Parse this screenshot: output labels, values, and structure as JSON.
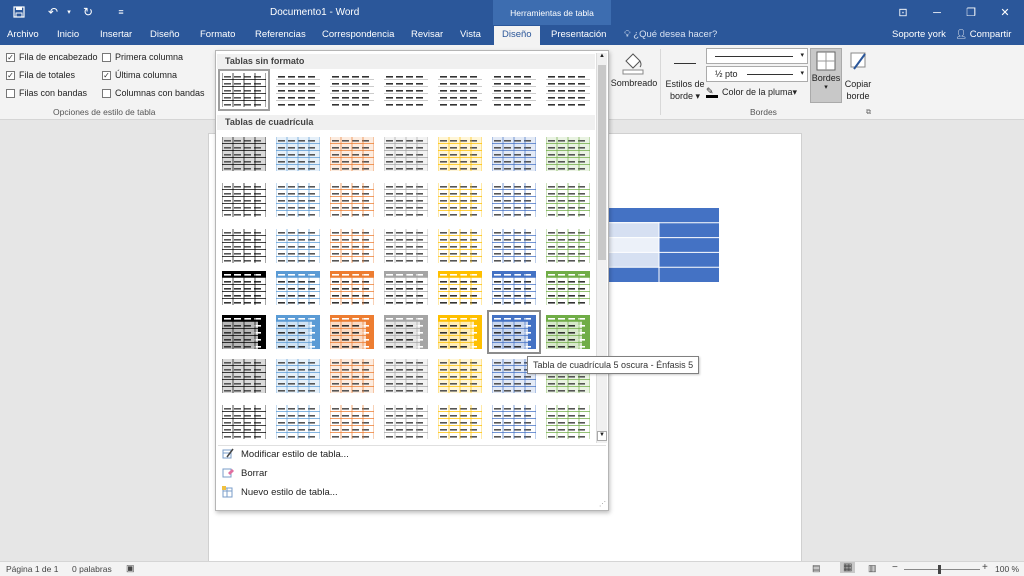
{
  "titlebar": {
    "title": "Documento1 - Word",
    "context_tab_group": "Herramientas de tabla"
  },
  "tabs": [
    "Archivo",
    "Inicio",
    "Insertar",
    "Diseño",
    "Formato",
    "Referencias",
    "Correspondencia",
    "Revisar",
    "Vista",
    "Diseño",
    "Presentación"
  ],
  "active_tab_index": 9,
  "tell_me": "¿Qué desea hacer?",
  "account": {
    "user": "Soporte york",
    "share": "Compartir"
  },
  "style_options": {
    "items": [
      {
        "label": "Fila de encabezado",
        "checked": true
      },
      {
        "label": "Fila de totales",
        "checked": true
      },
      {
        "label": "Filas con bandas",
        "checked": false
      },
      {
        "label": "Primera columna",
        "checked": false
      },
      {
        "label": "Última columna",
        "checked": true
      },
      {
        "label": "Columnas con bandas",
        "checked": false
      }
    ],
    "group_label": "Opciones de estilo de tabla"
  },
  "borders": {
    "sombreado": "Sombreado",
    "estilos_line1": "Estilos de",
    "estilos_line2": "borde",
    "weight": "½ pto",
    "pen_color": "Color de la pluma",
    "bordes": "Bordes",
    "copiar_line1": "Copiar",
    "copiar_line2": "borde",
    "group_label": "Bordes"
  },
  "gallery": {
    "section_plain": "Tablas sin formato",
    "section_grid": "Tablas de cuadrícula",
    "tooltip": "Tabla de cuadrícula 5 oscura - Énfasis 5",
    "menu": [
      {
        "label": "Modificar estilo de tabla...",
        "icon": "edit-table-style-icon"
      },
      {
        "label": "Borrar",
        "icon": "eraser-icon"
      },
      {
        "label": "Nuevo estilo de tabla...",
        "icon": "new-table-style-icon"
      }
    ],
    "accent_colors": [
      "#000000",
      "#5b9bd5",
      "#ed7d31",
      "#a5a5a5",
      "#ffc000",
      "#4472c4",
      "#70ad47"
    ]
  },
  "document": {
    "table_color": "#4472c4"
  },
  "status": {
    "page": "Página 1 de 1",
    "words": "0 palabras",
    "zoom": "100 %"
  }
}
